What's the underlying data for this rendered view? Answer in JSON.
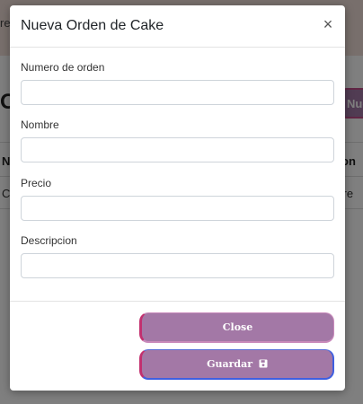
{
  "background": {
    "banner_text": "re",
    "heading": "OI",
    "new_button_label": "Nue",
    "table_header_left": "N",
    "table_header_right": "on",
    "row_left": "C",
    "row_right": "Sire"
  },
  "modal": {
    "title": "Nueva Orden de Cake",
    "close_symbol": "×",
    "fields": [
      {
        "label": "Numero de orden",
        "value": "",
        "placeholder": ""
      },
      {
        "label": "Nombre",
        "value": "",
        "placeholder": ""
      },
      {
        "label": "Precio",
        "value": "",
        "placeholder": ""
      },
      {
        "label": "Descripcion",
        "value": "",
        "placeholder": ""
      }
    ],
    "close_button_label": "Close",
    "save_button_label": "Guardar"
  },
  "icons": {
    "close": "close-icon",
    "save": "floppy-disk-icon"
  },
  "colors": {
    "button_fill": "#a378a6",
    "backdrop": "rgba(0,0,0,0.5)"
  }
}
